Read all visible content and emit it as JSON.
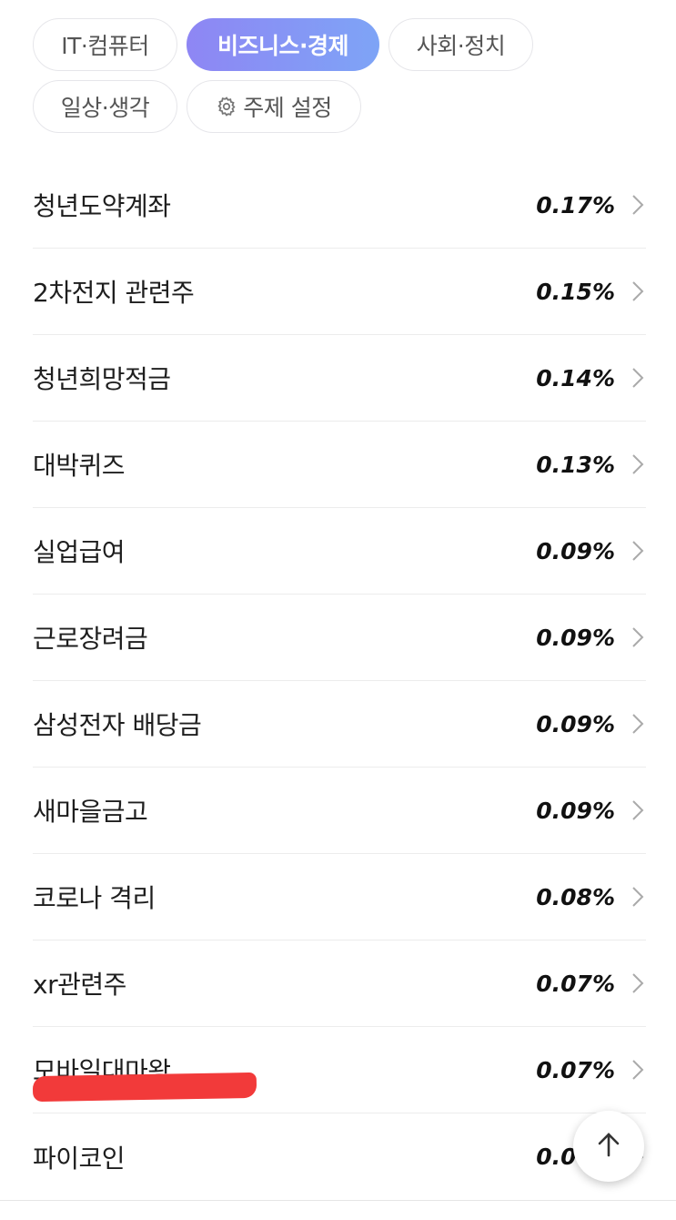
{
  "chips": {
    "row1": [
      {
        "label": "IT·컴퓨터",
        "active": false
      },
      {
        "label": "비즈니스·경제",
        "active": true
      },
      {
        "label": "사회·정치",
        "active": false
      }
    ],
    "row2": [
      {
        "label": "일상·생각",
        "active": false
      }
    ],
    "settings_label": "주제 설정"
  },
  "items": [
    {
      "label": "청년도약계좌",
      "pct": "0.17%"
    },
    {
      "label": "2차전지 관련주",
      "pct": "0.15%"
    },
    {
      "label": "청년희망적금",
      "pct": "0.14%"
    },
    {
      "label": "대박퀴즈",
      "pct": "0.13%"
    },
    {
      "label": "실업급여",
      "pct": "0.09%"
    },
    {
      "label": "근로장려금",
      "pct": "0.09%"
    },
    {
      "label": "삼성전자 배당금",
      "pct": "0.09%"
    },
    {
      "label": "새마을금고",
      "pct": "0.09%"
    },
    {
      "label": "코로나 격리",
      "pct": "0.08%"
    },
    {
      "label": "xr관련주",
      "pct": "0.07%"
    },
    {
      "label": "모바일대마왕",
      "pct": "0.07%"
    },
    {
      "label": "파이코인",
      "pct": "0.07%"
    }
  ],
  "icons": {
    "settings": "gear-icon",
    "chevron": "chevron-right-icon",
    "scroll_top": "arrow-up-icon"
  },
  "colors": {
    "chip_active_start": "#8e86f4",
    "chip_active_end": "#7ea4f6",
    "highlight_mark": "#f23a3a"
  }
}
